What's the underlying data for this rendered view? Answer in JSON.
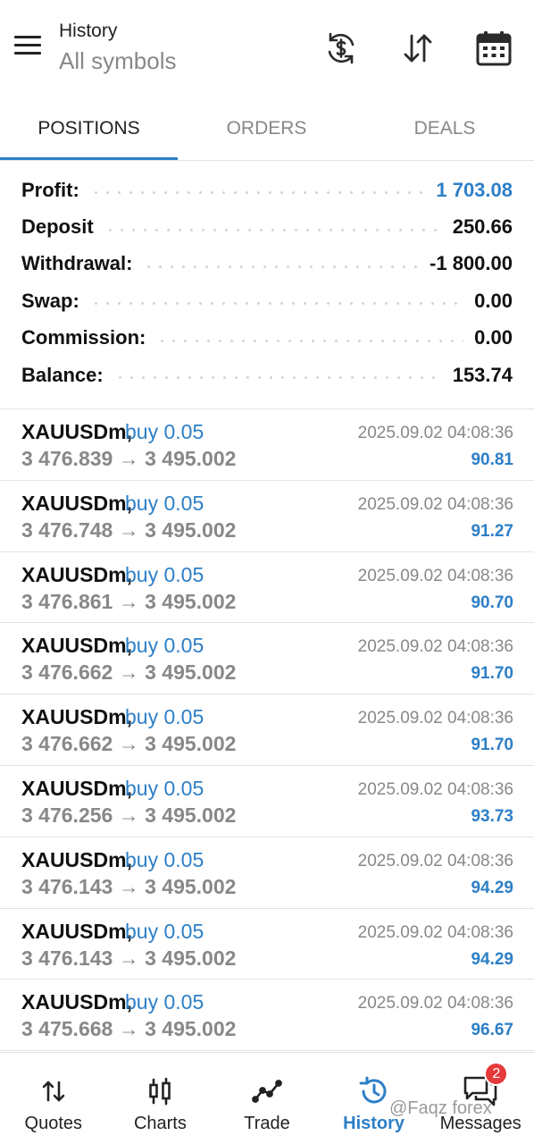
{
  "header": {
    "title": "History",
    "subtitle": "All symbols",
    "icons": [
      "menu-icon",
      "currency-exchange-icon",
      "sort-icon",
      "calendar-icon"
    ]
  },
  "tabs": [
    {
      "label": "POSITIONS",
      "active": true
    },
    {
      "label": "ORDERS",
      "active": false
    },
    {
      "label": "DEALS",
      "active": false
    }
  ],
  "summary": [
    {
      "label": "Profit:",
      "value": "1 703.08",
      "highlight": true
    },
    {
      "label": "Deposit",
      "value": "250.66",
      "highlight": false
    },
    {
      "label": "Withdrawal:",
      "value": "-1 800.00",
      "highlight": false
    },
    {
      "label": "Swap:",
      "value": "0.00",
      "highlight": false
    },
    {
      "label": "Commission:",
      "value": "0.00",
      "highlight": false
    },
    {
      "label": "Balance:",
      "value": "153.74",
      "highlight": false
    }
  ],
  "positions": [
    {
      "symbol": "XAUUSDm,",
      "side": "buy 0.05",
      "prices": "3 476.839 → 3 495.002",
      "time": "2025.09.02 04:08:36",
      "profit": "90.81"
    },
    {
      "symbol": "XAUUSDm,",
      "side": "buy 0.05",
      "prices": "3 476.748 → 3 495.002",
      "time": "2025.09.02 04:08:36",
      "profit": "91.27"
    },
    {
      "symbol": "XAUUSDm,",
      "side": "buy 0.05",
      "prices": "3 476.861 → 3 495.002",
      "time": "2025.09.02 04:08:36",
      "profit": "90.70"
    },
    {
      "symbol": "XAUUSDm,",
      "side": "buy 0.05",
      "prices": "3 476.662 → 3 495.002",
      "time": "2025.09.02 04:08:36",
      "profit": "91.70"
    },
    {
      "symbol": "XAUUSDm,",
      "side": "buy 0.05",
      "prices": "3 476.662 → 3 495.002",
      "time": "2025.09.02 04:08:36",
      "profit": "91.70"
    },
    {
      "symbol": "XAUUSDm,",
      "side": "buy 0.05",
      "prices": "3 476.256 → 3 495.002",
      "time": "2025.09.02 04:08:36",
      "profit": "93.73"
    },
    {
      "symbol": "XAUUSDm,",
      "side": "buy 0.05",
      "prices": "3 476.143 → 3 495.002",
      "time": "2025.09.02 04:08:36",
      "profit": "94.29"
    },
    {
      "symbol": "XAUUSDm,",
      "side": "buy 0.05",
      "prices": "3 476.143 → 3 495.002",
      "time": "2025.09.02 04:08:36",
      "profit": "94.29"
    },
    {
      "symbol": "XAUUSDm,",
      "side": "buy 0.05",
      "prices": "3 475.668 → 3 495.002",
      "time": "2025.09.02 04:08:36",
      "profit": "96.67"
    }
  ],
  "nav": [
    {
      "label": "Quotes",
      "icon": "quotes-icon",
      "active": false
    },
    {
      "label": "Charts",
      "icon": "charts-icon",
      "active": false
    },
    {
      "label": "Trade",
      "icon": "trade-icon",
      "active": false
    },
    {
      "label": "History",
      "icon": "history-icon",
      "active": true
    },
    {
      "label": "Messages",
      "icon": "messages-icon",
      "active": false,
      "badge": "2"
    }
  ],
  "watermark": "@Faqz forex",
  "colors": {
    "accent": "#2d7fc7",
    "muted": "#888888",
    "badge": "#e5393b"
  }
}
